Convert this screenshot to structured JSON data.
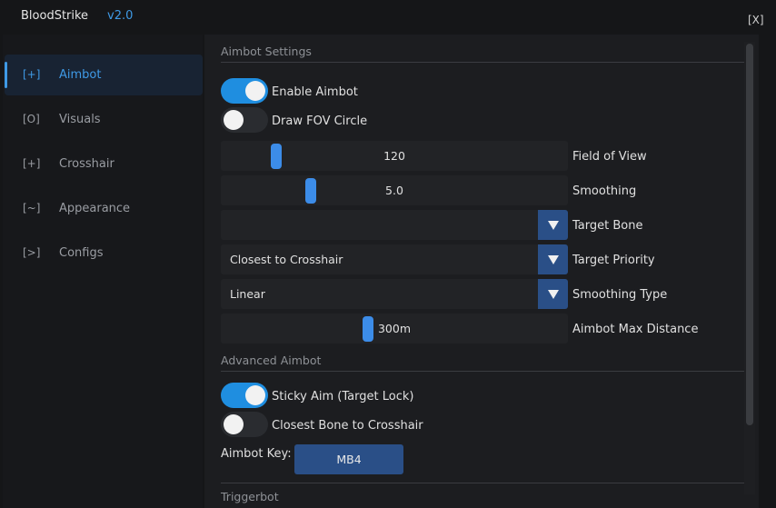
{
  "window": {
    "title": "BloodStrike",
    "version": "v2.0",
    "close_label": "[X]"
  },
  "sidebar": {
    "items": [
      {
        "prefix": "[+]",
        "label": "Aimbot",
        "active": true
      },
      {
        "prefix": "[O]",
        "label": "Visuals",
        "active": false
      },
      {
        "prefix": "[+]",
        "label": "Crosshair",
        "active": false
      },
      {
        "prefix": "[~]",
        "label": "Appearance",
        "active": false
      },
      {
        "prefix": "[>]",
        "label": "Configs",
        "active": false
      }
    ]
  },
  "aimbot_settings": {
    "section_title": "Aimbot Settings",
    "enable_aimbot": {
      "label": "Enable Aimbot",
      "on": true
    },
    "draw_fov_circle": {
      "label": "Draw FOV Circle",
      "on": false
    },
    "field_of_view": {
      "label": "Field of View",
      "value": "120"
    },
    "smoothing": {
      "label": "Smoothing",
      "value": "5.0"
    },
    "target_bone": {
      "label": "Target Bone",
      "value": ""
    },
    "target_priority": {
      "label": "Target Priority",
      "value": "Closest to Crosshair"
    },
    "smoothing_type": {
      "label": "Smoothing Type",
      "value": "Linear"
    },
    "aimbot_max_distance": {
      "label": "Aimbot Max Distance",
      "value": "300m"
    }
  },
  "advanced_aimbot": {
    "section_title": "Advanced Aimbot",
    "sticky_aim": {
      "label": "Sticky Aim (Target Lock)",
      "on": true
    },
    "closest_bone": {
      "label": "Closest Bone to Crosshair",
      "on": false
    },
    "aimbot_key_label": "Aimbot Key:",
    "aimbot_key_value": "MB4"
  },
  "triggerbot": {
    "section_title": "Triggerbot"
  },
  "colors": {
    "accent": "#3f9ae6",
    "toggle_on": "#1f8ee0",
    "dropdown_arrow_bg": "#2a4f87",
    "background": "#151618"
  }
}
